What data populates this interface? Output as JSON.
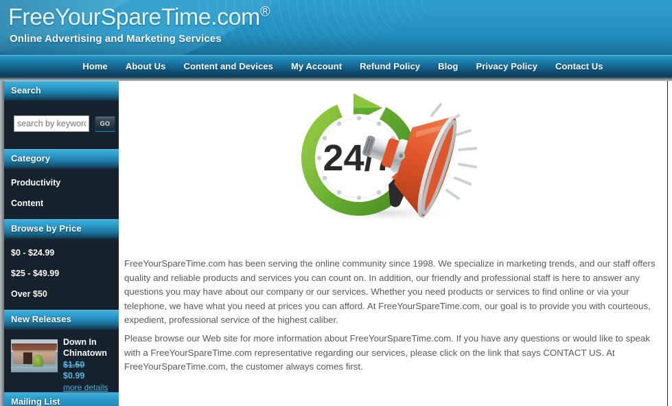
{
  "header": {
    "site_title": "FreeYourSpareTime.com",
    "registered_mark": "®",
    "tagline": "Online Advertising and Marketing Services"
  },
  "nav": {
    "items": [
      {
        "label": "Home"
      },
      {
        "label": "About Us"
      },
      {
        "label": "Content and Devices"
      },
      {
        "label": "My Account"
      },
      {
        "label": "Refund Policy"
      },
      {
        "label": "Blog"
      },
      {
        "label": "Privacy Policy"
      },
      {
        "label": "Contact Us"
      }
    ]
  },
  "sidebar": {
    "search": {
      "heading": "Search",
      "placeholder": "search by keyword",
      "value": "",
      "go_label": "GO"
    },
    "category": {
      "heading": "Category",
      "items": [
        {
          "label": "Productivity"
        },
        {
          "label": "Content"
        }
      ]
    },
    "browse_by_price": {
      "heading": "Browse by Price",
      "items": [
        {
          "label": "$0 - $24.99"
        },
        {
          "label": "$25 - $49.99"
        },
        {
          "label": "Over $50"
        }
      ]
    },
    "new_releases": {
      "heading": "New Releases",
      "product": {
        "title": "Down In Chinatown",
        "old_price": "$1.50",
        "new_price": "$0.99",
        "more_details_label": "more details",
        "thumbnail_alt": "chinatown-temple-photo"
      }
    },
    "mailing_list": {
      "heading": "Mailing List"
    }
  },
  "main": {
    "hero": {
      "image_alt": "24/7 clock with megaphone illustration",
      "clock_text": "24/7"
    },
    "paragraphs": [
      "FreeYourSpareTime.com has been serving the online community since 1998. We specialize in marketing trends, and our staff offers quality and reliable products and services you can count on. In addition, our friendly and professional staff is here to answer any questions you may have about our company or our services. Whether you need products or services to find online or via your telephone, we have what you need at prices you can afford. At FreeYourSpareTime.com, our goal is to provide you with courteous, expedient, professional service of the highest caliber.",
      "Please browse our Web site for more information about FreeYourSpareTime.com. If you have any questions or would like to speak with a FreeYourSpareTime.com representative regarding our services, please click on the link that says CONTACT US. At FreeYourSpareTime.com, the customer always comes first."
    ]
  },
  "colors": {
    "brand_blue": "#2e9fce",
    "nav_dark": "#123d58",
    "sidebar_bg": "#162430",
    "accent_link": "#49aedc",
    "price_blue": "#53b7e0",
    "body_text": "#555a5e",
    "clock_green": "#6fb536",
    "megaphone_orange": "#e0562a"
  }
}
